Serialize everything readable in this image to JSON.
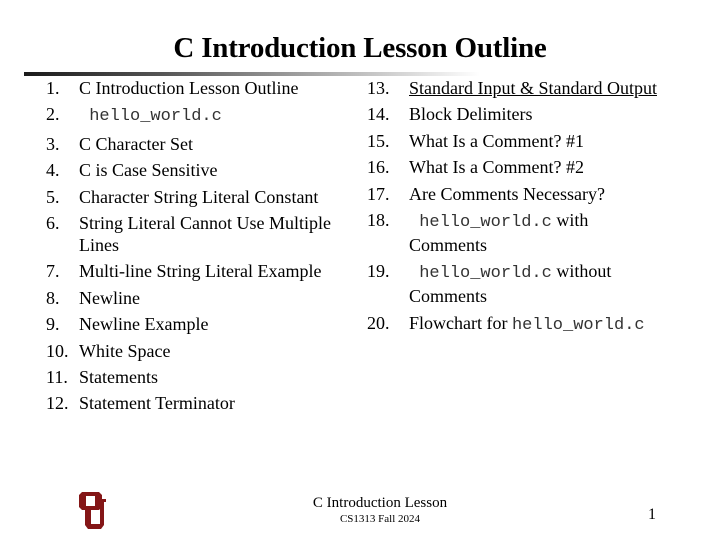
{
  "slide": {
    "title": "C Introduction Lesson Outline",
    "left_items": [
      {
        "num": "1.",
        "parts": [
          {
            "text": "C Introduction Lesson Outline",
            "style": "normal"
          }
        ]
      },
      {
        "num": "2.",
        "parts": [
          {
            "text": " hello_world.c",
            "style": "code"
          }
        ]
      },
      {
        "num": "3.",
        "parts": [
          {
            "text": "C Character Set",
            "style": "normal"
          }
        ]
      },
      {
        "num": "4.",
        "parts": [
          {
            "text": "C is Case Sensitive",
            "style": "normal"
          }
        ]
      },
      {
        "num": "5.",
        "parts": [
          {
            "text": "Character String Literal Constant",
            "style": "normal"
          }
        ]
      },
      {
        "num": "6.",
        "parts": [
          {
            "text": "String Literal Cannot Use Multiple Lines",
            "style": "normal"
          }
        ]
      },
      {
        "num": "7.",
        "parts": [
          {
            "text": "Multi-line String Literal Example",
            "style": "normal"
          }
        ]
      },
      {
        "num": "8.",
        "parts": [
          {
            "text": "Newline",
            "style": "normal"
          }
        ]
      },
      {
        "num": "9.",
        "parts": [
          {
            "text": "Newline Example",
            "style": "normal"
          }
        ]
      },
      {
        "num": "10.",
        "parts": [
          {
            "text": "White Space",
            "style": "normal"
          }
        ]
      },
      {
        "num": "11.",
        "parts": [
          {
            "text": "Statements",
            "style": "normal"
          }
        ]
      },
      {
        "num": "12.",
        "parts": [
          {
            "text": "Statement Terminator",
            "style": "normal"
          }
        ]
      }
    ],
    "right_items": [
      {
        "num": "13.",
        "parts": [
          {
            "text": "Standard Input & Standard Output",
            "style": "link"
          }
        ]
      },
      {
        "num": "14.",
        "parts": [
          {
            "text": "Block Delimiters",
            "style": "normal"
          }
        ]
      },
      {
        "num": "15.",
        "parts": [
          {
            "text": "What Is a Comment? #1",
            "style": "normal"
          }
        ]
      },
      {
        "num": "16.",
        "parts": [
          {
            "text": "What Is a Comment? #2",
            "style": "normal"
          }
        ]
      },
      {
        "num": "17.",
        "parts": [
          {
            "text": "Are Comments Necessary?",
            "style": "normal"
          }
        ]
      },
      {
        "num": "18.",
        "parts": [
          {
            "text": " hello_world.c",
            "style": "code"
          },
          {
            "text": " with Comments",
            "style": "normal"
          }
        ]
      },
      {
        "num": "19.",
        "parts": [
          {
            "text": " hello_world.c",
            "style": "code"
          },
          {
            "text": " without Comments",
            "style": "normal"
          }
        ]
      },
      {
        "num": "20.",
        "parts": [
          {
            "text": "Flowchart for ",
            "style": "normal"
          },
          {
            "text": "hello_world.c",
            "style": "code"
          }
        ]
      }
    ]
  },
  "footer": {
    "title": "C Introduction Lesson",
    "subtitle": "CS1313 Fall 2024",
    "page_number": "1",
    "logo_icon": "ou-logo-icon",
    "logo_color": "#841617"
  }
}
